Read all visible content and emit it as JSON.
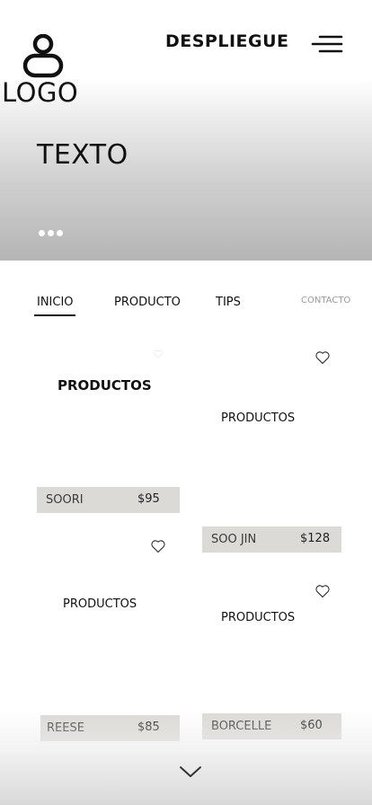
{
  "header": {
    "logo_text": "LOGO",
    "title": "DESPLIEGUE",
    "logo_icon": "user-icon",
    "menu_icon": "menu-icon"
  },
  "hero": {
    "text": "TEXTO",
    "slides": 3
  },
  "nav": {
    "items": [
      {
        "label": "INICIO",
        "active": true
      },
      {
        "label": "PRODUCTO",
        "active": false
      },
      {
        "label": "TIPS",
        "active": false
      },
      {
        "label": "CONTACTO",
        "active": false
      }
    ]
  },
  "products": [
    {
      "title": "PRODUCTOS",
      "name": "SOORI",
      "price": "$95"
    },
    {
      "title": "PRODUCTOS",
      "name": "SOO JIN",
      "price": "$128"
    },
    {
      "title": "PRODUCTOS",
      "name": "REESE",
      "price": "$85"
    },
    {
      "title": "PRODUCTOS",
      "name": "BORCELLE",
      "price": "$60"
    }
  ],
  "icons": {
    "favorite": "heart-icon",
    "scroll_down": "chevron-down-icon"
  },
  "colors": {
    "price_bar": "#dcdad6",
    "text": "#111111",
    "inactive_nav": "#9a9a9a"
  }
}
